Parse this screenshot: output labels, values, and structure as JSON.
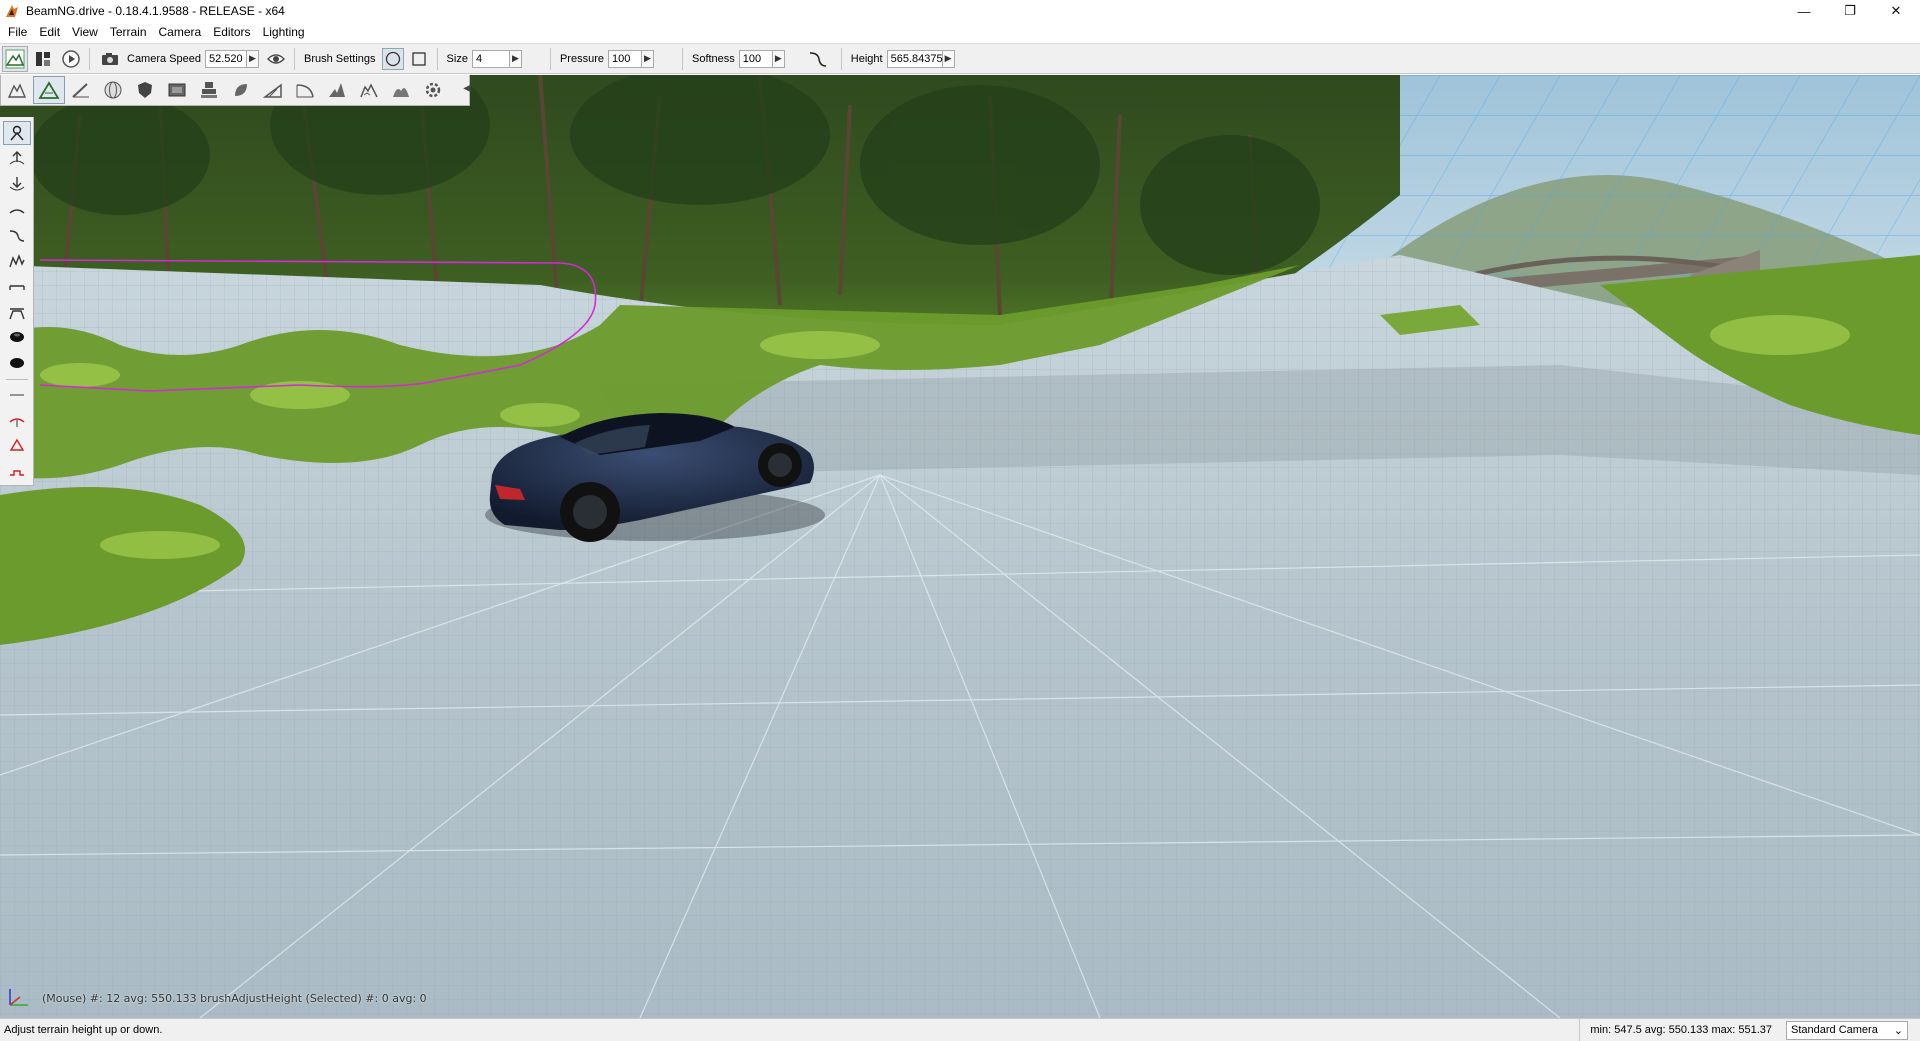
{
  "window": {
    "title": "BeamNG.drive - 0.18.4.1.9588 - RELEASE - x64",
    "minimize_glyph": "—",
    "restore_glyph": "❐",
    "close_glyph": "✕"
  },
  "menu": [
    "File",
    "Edit",
    "View",
    "Terrain",
    "Camera",
    "Editors",
    "Lighting"
  ],
  "toolbar": {
    "camera_speed_label": "Camera Speed",
    "camera_speed_value": "52.520",
    "brush_settings_label": "Brush Settings",
    "size_label": "Size",
    "size_value": "4",
    "pressure_label": "Pressure",
    "pressure_value": "100",
    "softness_label": "Softness",
    "softness_value": "100",
    "height_label": "Height",
    "height_value": "565.84375",
    "arrow_glyph": "▶"
  },
  "toolstrip": {
    "collapse_glyph": "◀"
  },
  "viewport": {
    "readout": "(Mouse) #: 12  avg: 550.133 brushAdjustHeight   (Selected) #: 0  avg: 0"
  },
  "statusbar": {
    "message": "Adjust terrain height up or down.",
    "stats": "min: 547.5  avg: 550.133  max: 551.37",
    "camera_mode": "Standard Camera",
    "dropdown_glyph": "⌄"
  },
  "colors": {
    "toolbar_bg": "#f0f0f0",
    "brush_outline": "#d22bd2",
    "car_body": "#1c2a44",
    "terrain_grid": "#b8c8d3",
    "foliage": "#5e8f2a"
  }
}
